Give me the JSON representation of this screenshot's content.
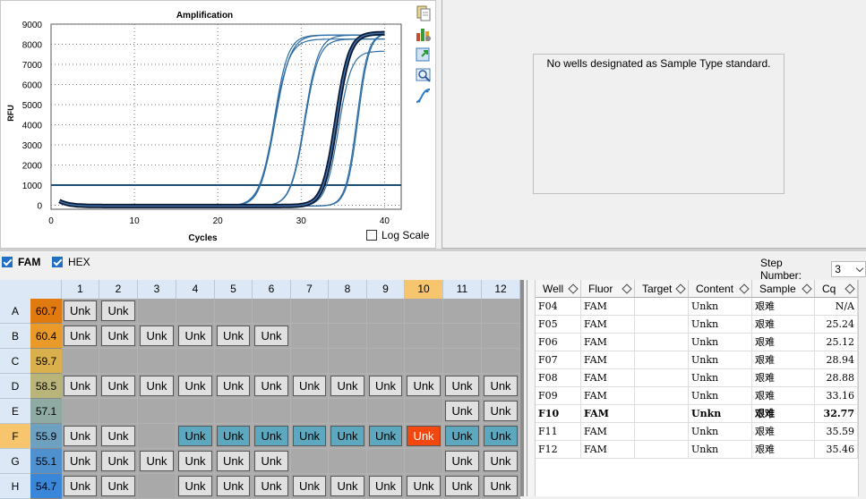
{
  "chart": {
    "title": "Amplification",
    "xlabel": "Cycles",
    "ylabel": "RFU",
    "log_scale_label": "Log Scale",
    "log_scale_checked": false,
    "threshold_color": "#1c4f78",
    "highlight_color": "#0a1a33",
    "curve_color": "#2e6da4"
  },
  "chart_data": {
    "type": "line",
    "title": "Amplification",
    "xlabel": "Cycles",
    "ylabel": "RFU",
    "xlim": [
      0,
      42
    ],
    "ylim": [
      -200,
      9000
    ],
    "xticks": [
      0,
      10,
      20,
      30,
      40
    ],
    "yticks": [
      0,
      1000,
      2000,
      3000,
      4000,
      5000,
      6000,
      7000,
      8000,
      9000
    ],
    "threshold": 1000,
    "grid": true,
    "series": [
      {
        "well": "F04",
        "cq": 25.24,
        "max": 8500,
        "slope": 1.2,
        "bold": false
      },
      {
        "well": "F05",
        "cq": 25.24,
        "max": 8500,
        "slope": 1.1,
        "bold": false
      },
      {
        "well": "F06",
        "cq": 25.12,
        "max": 8300,
        "slope": 1.1,
        "bold": false
      },
      {
        "well": "F07",
        "cq": 28.94,
        "max": 8300,
        "slope": 1.2,
        "bold": false
      },
      {
        "well": "F08",
        "cq": 28.88,
        "max": 8500,
        "slope": 1.2,
        "bold": false
      },
      {
        "well": "F09",
        "cq": 33.16,
        "max": 7700,
        "slope": 1.3,
        "bold": false
      },
      {
        "well": "F10",
        "cq": 32.77,
        "max": 8600,
        "slope": 1.25,
        "bold": true
      },
      {
        "well": "F11",
        "cq": 35.59,
        "max": 8600,
        "slope": 1.5,
        "bold": false
      },
      {
        "well": "F12",
        "cq": 35.46,
        "max": 8600,
        "slope": 1.5,
        "bold": false
      }
    ]
  },
  "standard_message": "No wells designated as Sample Type standard.",
  "fluors": [
    {
      "label": "FAM",
      "checked": true,
      "bold": true
    },
    {
      "label": "HEX",
      "checked": true,
      "bold": false
    }
  ],
  "step": {
    "label": "Step Number:",
    "value": "3"
  },
  "plate": {
    "columns": [
      "1",
      "2",
      "3",
      "4",
      "5",
      "6",
      "7",
      "8",
      "9",
      "10",
      "11",
      "12"
    ],
    "selected_column": "10",
    "selected_row": "F",
    "rows": [
      {
        "label": "A",
        "tm": "60.7",
        "tm_color": "#e07a0f",
        "wells": [
          "Unk",
          "Unk",
          "",
          "",
          "",
          "",
          "",
          "",
          "",
          "",
          "",
          ""
        ]
      },
      {
        "label": "B",
        "tm": "60.4",
        "tm_color": "#e99a28",
        "wells": [
          "Unk",
          "Unk",
          "Unk",
          "Unk",
          "Unk",
          "Unk",
          "",
          "",
          "",
          "",
          "",
          ""
        ]
      },
      {
        "label": "C",
        "tm": "59.7",
        "tm_color": "#d9b04c",
        "wells": [
          "",
          "",
          "",
          "",
          "",
          "",
          "",
          "",
          "",
          "",
          "",
          ""
        ]
      },
      {
        "label": "D",
        "tm": "58.5",
        "tm_color": "#b8b47a",
        "wells": [
          "Unk",
          "Unk",
          "Unk",
          "Unk",
          "Unk",
          "Unk",
          "Unk",
          "Unk",
          "Unk",
          "Unk",
          "Unk",
          "Unk"
        ]
      },
      {
        "label": "E",
        "tm": "57.1",
        "tm_color": "#8fa9a3",
        "wells": [
          "",
          "",
          "",
          "",
          "",
          "",
          "",
          "",
          "",
          "",
          "Unk",
          "Unk"
        ]
      },
      {
        "label": "F",
        "tm": "55.9",
        "tm_color": "#6ea0c0",
        "wells": [
          "Unk",
          "Unk",
          "",
          "Unk",
          "Unk",
          "Unk",
          "Unk",
          "Unk",
          "Unk",
          "Unk",
          "Unk",
          "Unk"
        ]
      },
      {
        "label": "G",
        "tm": "55.1",
        "tm_color": "#4f90cf",
        "wells": [
          "Unk",
          "Unk",
          "Unk",
          "Unk",
          "Unk",
          "Unk",
          "",
          "",
          "",
          "",
          "Unk",
          "Unk"
        ]
      },
      {
        "label": "H",
        "tm": "54.7",
        "tm_color": "#3a86d8",
        "wells": [
          "Unk",
          "Unk",
          "",
          "Unk",
          "Unk",
          "Unk",
          "Unk",
          "Unk",
          "Unk",
          "Unk",
          "Unk",
          "Unk"
        ]
      }
    ]
  },
  "table": {
    "headers": [
      "Well",
      "Fluor",
      "Target",
      "Content",
      "Sample",
      "Cq"
    ],
    "rows": [
      {
        "well": "F04",
        "fluor": "FAM",
        "target": "",
        "content": "Unkn",
        "sample": "艰难",
        "cq": "N/A"
      },
      {
        "well": "F05",
        "fluor": "FAM",
        "target": "",
        "content": "Unkn",
        "sample": "艰难",
        "cq": "25.24"
      },
      {
        "well": "F06",
        "fluor": "FAM",
        "target": "",
        "content": "Unkn",
        "sample": "艰难",
        "cq": "25.12"
      },
      {
        "well": "F07",
        "fluor": "FAM",
        "target": "",
        "content": "Unkn",
        "sample": "艰难",
        "cq": "28.94"
      },
      {
        "well": "F08",
        "fluor": "FAM",
        "target": "",
        "content": "Unkn",
        "sample": "艰难",
        "cq": "28.88"
      },
      {
        "well": "F09",
        "fluor": "FAM",
        "target": "",
        "content": "Unkn",
        "sample": "艰难",
        "cq": "33.16"
      },
      {
        "well": "F10",
        "fluor": "FAM",
        "target": "",
        "content": "Unkn",
        "sample": "艰难",
        "cq": "32.77",
        "bold": true
      },
      {
        "well": "F11",
        "fluor": "FAM",
        "target": "",
        "content": "Unkn",
        "sample": "艰难",
        "cq": "35.59"
      },
      {
        "well": "F12",
        "fluor": "FAM",
        "target": "",
        "content": "Unkn",
        "sample": "艰难",
        "cq": "35.46"
      }
    ]
  },
  "icons": [
    "copy-icon",
    "chart-settings-icon",
    "export-icon",
    "zoom-icon",
    "curve-icon"
  ]
}
